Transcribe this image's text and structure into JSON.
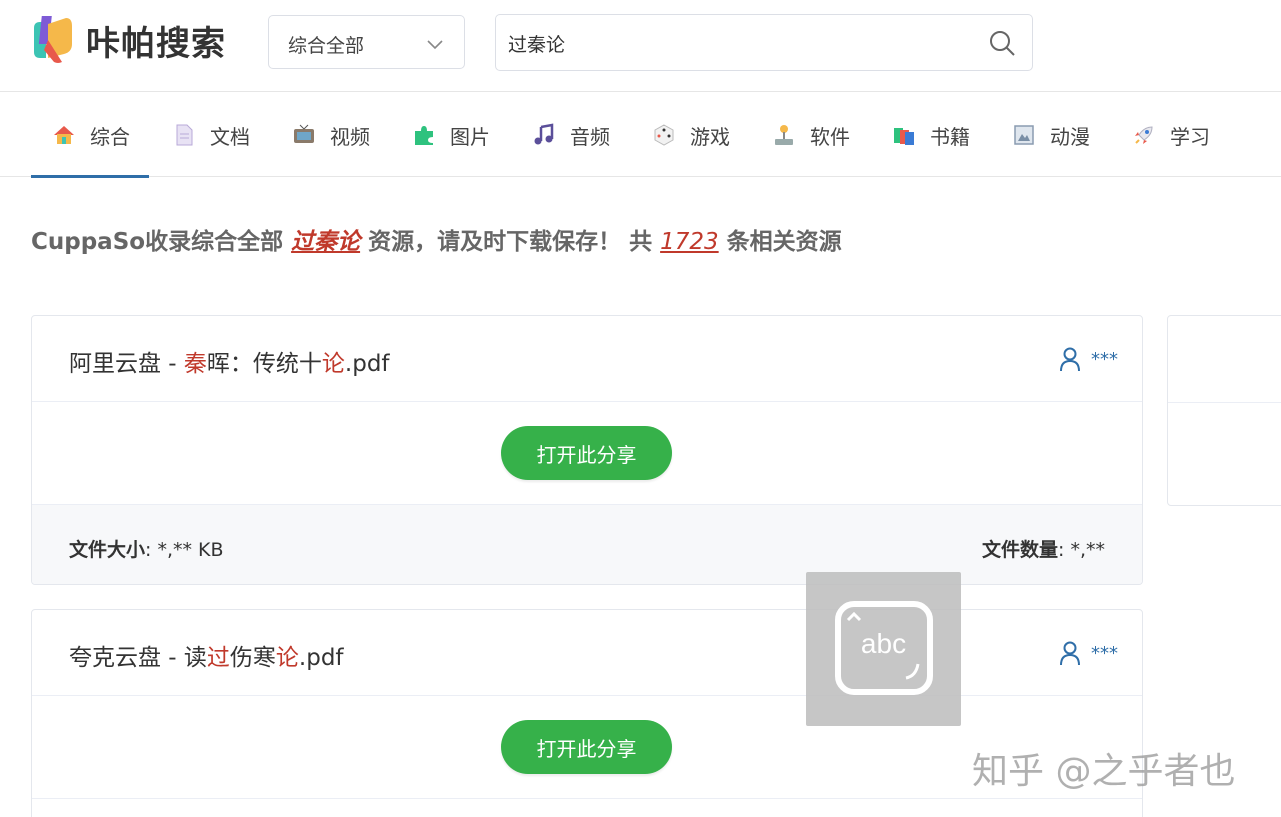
{
  "header": {
    "logo_text": "咔帕搜索",
    "category_select": "综合全部",
    "search_value": "过秦论"
  },
  "nav": [
    {
      "label": "综合",
      "icon": "house-icon",
      "active": true
    },
    {
      "label": "文档",
      "icon": "document-icon",
      "active": false
    },
    {
      "label": "视频",
      "icon": "tv-icon",
      "active": false
    },
    {
      "label": "图片",
      "icon": "puzzle-icon",
      "active": false
    },
    {
      "label": "音频",
      "icon": "music-note-icon",
      "active": false
    },
    {
      "label": "游戏",
      "icon": "dice-icon",
      "active": false
    },
    {
      "label": "软件",
      "icon": "joystick-icon",
      "active": false
    },
    {
      "label": "书籍",
      "icon": "books-icon",
      "active": false
    },
    {
      "label": "动漫",
      "icon": "frame-icon",
      "active": false
    },
    {
      "label": "学习",
      "icon": "rocket-icon",
      "active": false
    }
  ],
  "summary": {
    "prefix": "CuppaSo收录综合全部 ",
    "keyword": "过秦论",
    "middle": " 资源，请及时下载保存！ 共 ",
    "count": "1723",
    "suffix": " 条相关资源"
  },
  "results": [
    {
      "title_parts": [
        {
          "text": "阿里云盘 - ",
          "hl": false
        },
        {
          "text": "秦",
          "hl": true
        },
        {
          "text": "晖：传统十",
          "hl": false
        },
        {
          "text": "论",
          "hl": true
        },
        {
          "text": ".pdf",
          "hl": false
        }
      ],
      "user": "***",
      "button_label": "打开此分享",
      "size_label": "文件大小",
      "size_value": ": *,** KB",
      "count_label": "文件数量",
      "count_value": ": *,**"
    },
    {
      "title_parts": [
        {
          "text": "夸克云盘 - 读",
          "hl": false
        },
        {
          "text": "过",
          "hl": true
        },
        {
          "text": "伤寒",
          "hl": false
        },
        {
          "text": "论",
          "hl": true
        },
        {
          "text": ".pdf",
          "hl": false
        }
      ],
      "user": "***",
      "button_label": "打开此分享"
    }
  ],
  "ime_overlay": {
    "label": "abc"
  },
  "watermark": "知乎 @之乎者也",
  "colors": {
    "accent": "#2f6ea8",
    "highlight": "#c0392b",
    "button": "#36b14a"
  }
}
